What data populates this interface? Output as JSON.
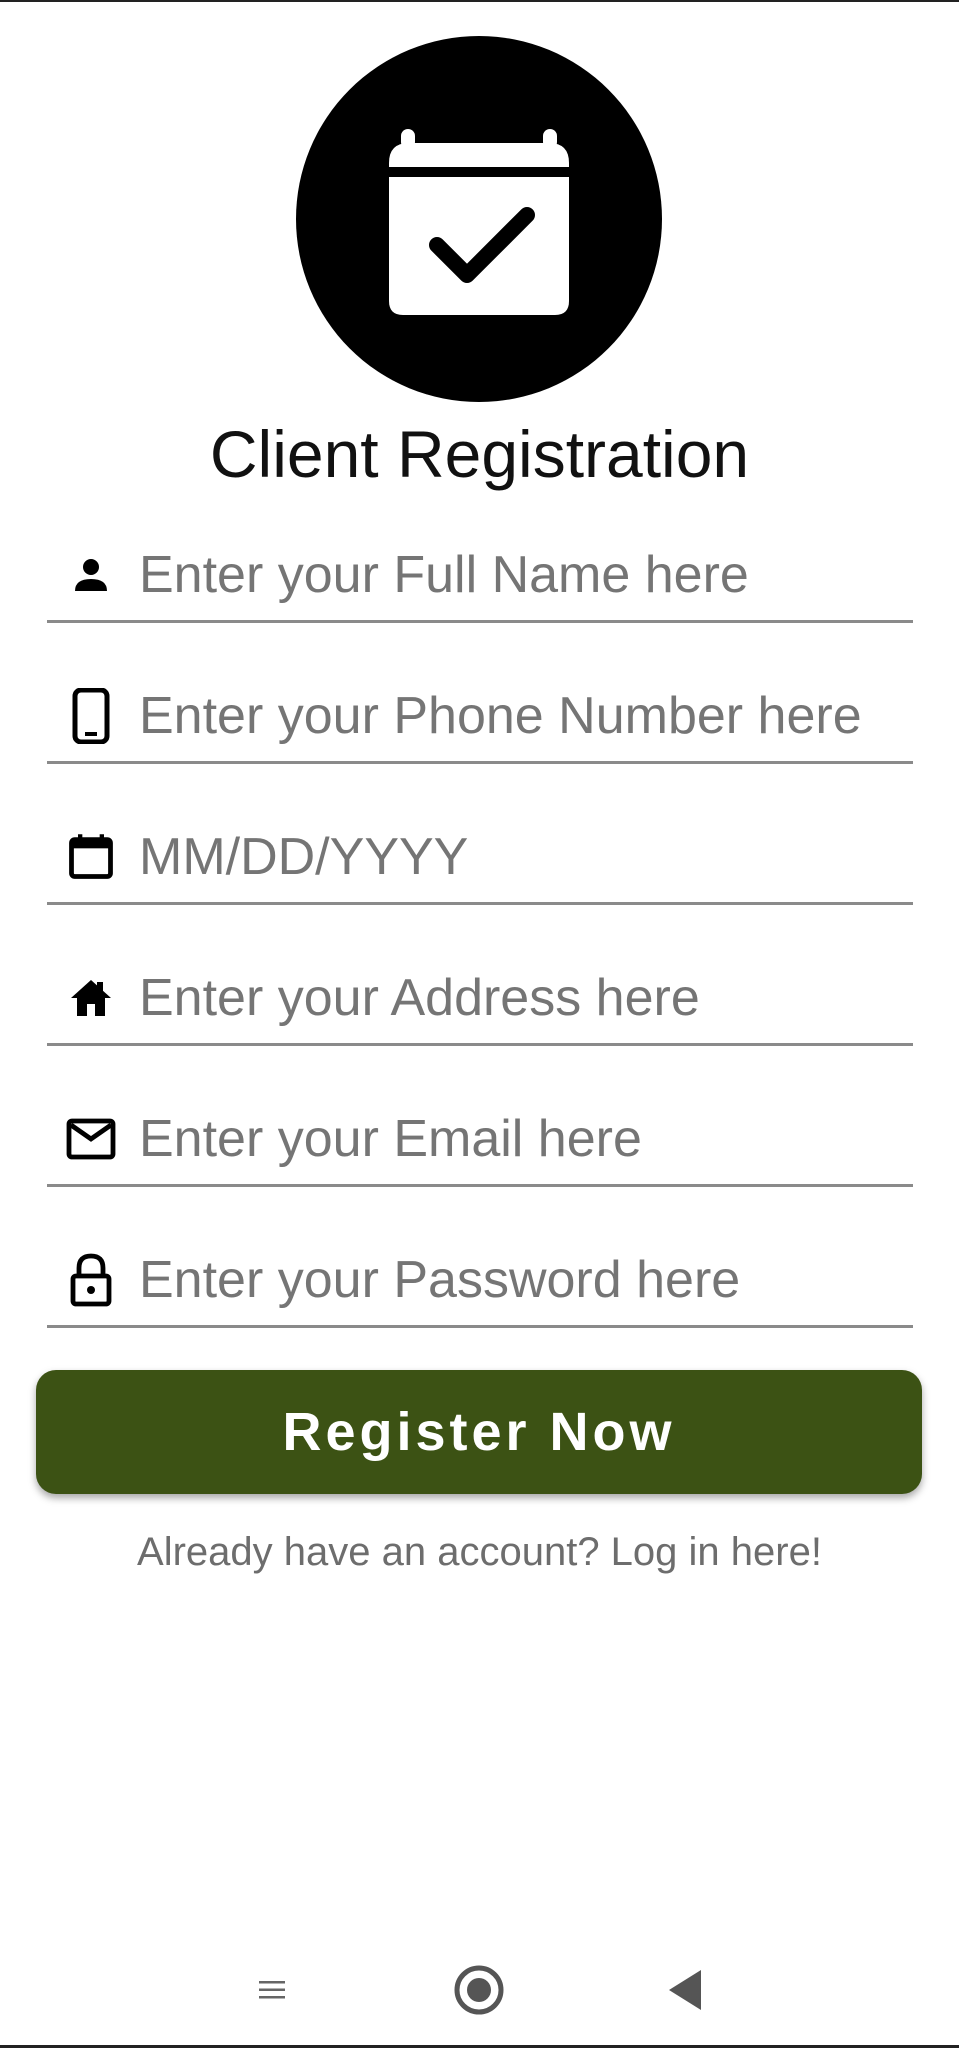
{
  "header": {
    "logo_icon": "calendar-check-icon",
    "title": "Client Registration"
  },
  "form": {
    "fields": [
      {
        "icon": "person-icon",
        "placeholder": "Enter your Full Name here",
        "value": ""
      },
      {
        "icon": "phone-icon",
        "placeholder": "Enter your Phone Number here",
        "value": ""
      },
      {
        "icon": "calendar-icon",
        "placeholder": "MM/DD/YYYY",
        "value": ""
      },
      {
        "icon": "home-icon",
        "placeholder": "Enter your Address here",
        "value": ""
      },
      {
        "icon": "mail-icon",
        "placeholder": "Enter your Email here",
        "value": ""
      },
      {
        "icon": "lock-icon",
        "placeholder": "Enter your Password here",
        "value": ""
      }
    ],
    "register_label": "Register Now",
    "login_link": "Already have an account? Log in here!"
  },
  "colors": {
    "button": "#3c5214",
    "placeholder": "#757575",
    "underline": "#8a8a8a"
  },
  "nav": {
    "icons": [
      "menu-icon",
      "home-circle-icon",
      "back-triangle-icon"
    ]
  }
}
